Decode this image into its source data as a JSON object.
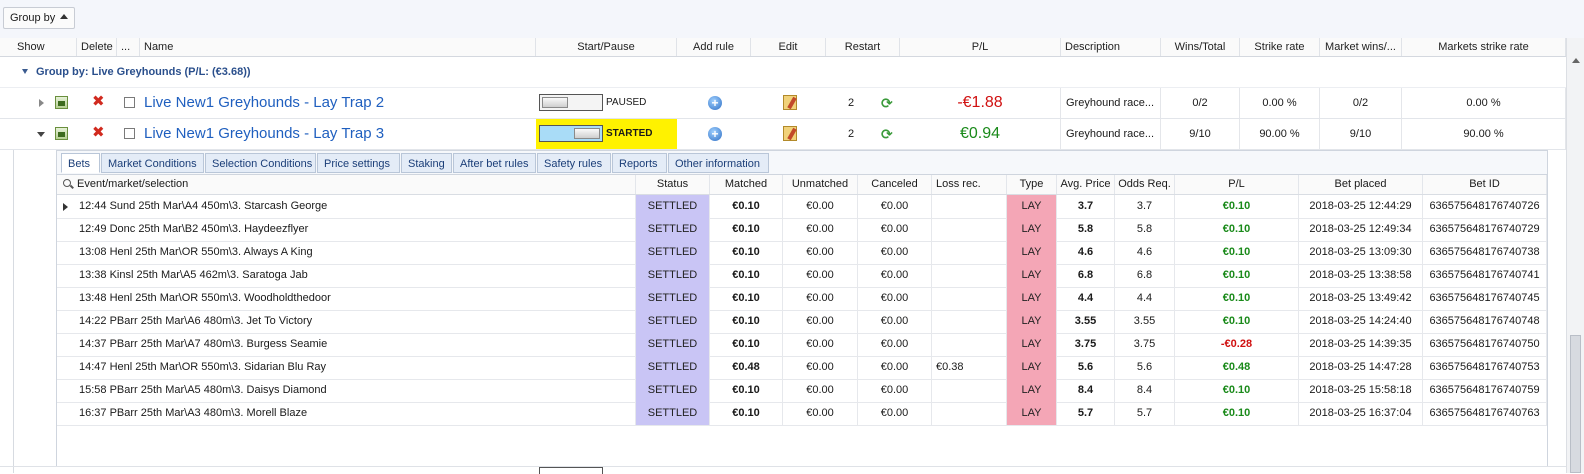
{
  "toolbar": {
    "group_by_label": "Group by"
  },
  "columns": {
    "show": "Show",
    "delete": "Delete",
    "more": "...",
    "name": "Name",
    "start_pause": "Start/Pause",
    "add_rule": "Add rule",
    "edit": "Edit",
    "restart": "Restart",
    "pl": "P/L",
    "description": "Description",
    "wins_total": "Wins/Total",
    "strike_rate": "Strike rate",
    "market_wins": "Market wins/...",
    "markets_strike_rate": "Markets strike rate"
  },
  "group": {
    "title": "Group by: Live Greyhounds (P/L: (€3.68))"
  },
  "strategies": [
    {
      "name": "Live New1 Greyhounds - Lay Trap 2",
      "state": "PAUSED",
      "restart": "2",
      "pl": "-€1.88",
      "pl_color": "#d01010",
      "description": "Greyhound race...",
      "wins_total": "0/2",
      "strike_rate": "0.00 %",
      "market_wins": "0/2",
      "markets_strike_rate": "0.00 %"
    },
    {
      "name": "Live New1 Greyhounds - Lay Trap 3",
      "state": "STARTED",
      "restart": "2",
      "pl": "€0.94",
      "pl_color": "#1a8a1a",
      "description": "Greyhound race...",
      "wins_total": "9/10",
      "strike_rate": "90.00 %",
      "market_wins": "9/10",
      "markets_strike_rate": "90.00 %"
    }
  ],
  "tabs": [
    "Bets",
    "Market Conditions",
    "Selection Conditions",
    "Price settings",
    "Staking",
    "After bet rules",
    "Safety rules",
    "Reports",
    "Other information"
  ],
  "bets_columns": {
    "event": "Event/market/selection",
    "status": "Status",
    "matched": "Matched",
    "unmatched": "Unmatched",
    "canceled": "Canceled",
    "loss_rec": "Loss rec.",
    "type": "Type",
    "avg_price": "Avg. Price",
    "odds_req": "Odds Req.",
    "pl": "P/L",
    "bet_placed": "Bet placed",
    "bet_id": "Bet ID"
  },
  "bets": [
    {
      "event": "12:44 Sund 25th Mar\\A4 450m\\3. Starcash George",
      "status": "SETTLED",
      "matched": "€0.10",
      "unmatched": "€0.00",
      "canceled": "€0.00",
      "loss_rec": "",
      "type": "LAY",
      "avg_price": "3.7",
      "odds_req": "3.7",
      "pl": "€0.10",
      "bet_placed": "2018-03-25 12:44:29",
      "bet_id": "636575648176740726"
    },
    {
      "event": "12:49 Donc 25th Mar\\B2 450m\\3. Haydeezflyer",
      "status": "SETTLED",
      "matched": "€0.10",
      "unmatched": "€0.00",
      "canceled": "€0.00",
      "loss_rec": "",
      "type": "LAY",
      "avg_price": "5.8",
      "odds_req": "5.8",
      "pl": "€0.10",
      "bet_placed": "2018-03-25 12:49:34",
      "bet_id": "636575648176740729"
    },
    {
      "event": "13:08 Henl 25th Mar\\OR 550m\\3. Always A King",
      "status": "SETTLED",
      "matched": "€0.10",
      "unmatched": "€0.00",
      "canceled": "€0.00",
      "loss_rec": "",
      "type": "LAY",
      "avg_price": "4.6",
      "odds_req": "4.6",
      "pl": "€0.10",
      "bet_placed": "2018-03-25 13:09:30",
      "bet_id": "636575648176740738"
    },
    {
      "event": "13:38 Kinsl 25th Mar\\A5 462m\\3. Saratoga Jab",
      "status": "SETTLED",
      "matched": "€0.10",
      "unmatched": "€0.00",
      "canceled": "€0.00",
      "loss_rec": "",
      "type": "LAY",
      "avg_price": "6.8",
      "odds_req": "6.8",
      "pl": "€0.10",
      "bet_placed": "2018-03-25 13:38:58",
      "bet_id": "636575648176740741"
    },
    {
      "event": "13:48 Henl 25th Mar\\OR 550m\\3. Woodholdthedoor",
      "status": "SETTLED",
      "matched": "€0.10",
      "unmatched": "€0.00",
      "canceled": "€0.00",
      "loss_rec": "",
      "type": "LAY",
      "avg_price": "4.4",
      "odds_req": "4.4",
      "pl": "€0.10",
      "bet_placed": "2018-03-25 13:49:42",
      "bet_id": "636575648176740745"
    },
    {
      "event": "14:22 PBarr 25th Mar\\A6 480m\\3. Jet To Victory",
      "status": "SETTLED",
      "matched": "€0.10",
      "unmatched": "€0.00",
      "canceled": "€0.00",
      "loss_rec": "",
      "type": "LAY",
      "avg_price": "3.55",
      "odds_req": "3.55",
      "pl": "€0.10",
      "bet_placed": "2018-03-25 14:24:40",
      "bet_id": "636575648176740748"
    },
    {
      "event": "14:37 PBarr 25th Mar\\A7 480m\\3. Burgess Seamie",
      "status": "SETTLED",
      "matched": "€0.10",
      "unmatched": "€0.00",
      "canceled": "€0.00",
      "loss_rec": "",
      "type": "LAY",
      "avg_price": "3.75",
      "odds_req": "3.75",
      "pl": "-€0.28",
      "bet_placed": "2018-03-25 14:39:35",
      "bet_id": "636575648176740750"
    },
    {
      "event": "14:47 Henl 25th Mar\\OR 550m\\3. Sidarian Blu Ray",
      "status": "SETTLED",
      "matched": "€0.48",
      "unmatched": "€0.00",
      "canceled": "€0.00",
      "loss_rec": "€0.38",
      "type": "LAY",
      "avg_price": "5.6",
      "odds_req": "5.6",
      "pl": "€0.48",
      "bet_placed": "2018-03-25 14:47:28",
      "bet_id": "636575648176740753"
    },
    {
      "event": "15:58 PBarr 25th Mar\\A5 480m\\3. Daisys Diamond",
      "status": "SETTLED",
      "matched": "€0.10",
      "unmatched": "€0.00",
      "canceled": "€0.00",
      "loss_rec": "",
      "type": "LAY",
      "avg_price": "8.4",
      "odds_req": "8.4",
      "pl": "€0.10",
      "bet_placed": "2018-03-25 15:58:18",
      "bet_id": "636575648176740759"
    },
    {
      "event": "16:37 PBarr 25th Mar\\A3 480m\\3. Morell Blaze",
      "status": "SETTLED",
      "matched": "€0.10",
      "unmatched": "€0.00",
      "canceled": "€0.00",
      "loss_rec": "",
      "type": "LAY",
      "avg_price": "5.7",
      "odds_req": "5.7",
      "pl": "€0.10",
      "bet_placed": "2018-03-25 16:37:04",
      "bet_id": "636575648176740763"
    }
  ]
}
